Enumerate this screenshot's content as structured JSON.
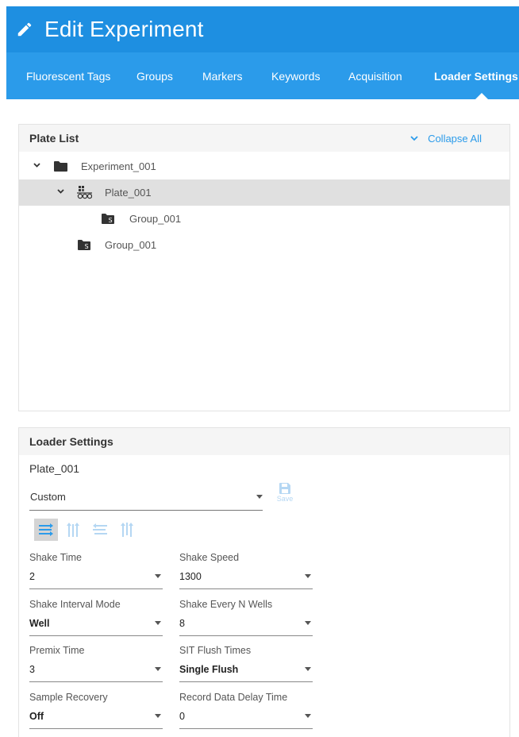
{
  "header": {
    "title": "Edit Experiment",
    "icon": "pencil-icon"
  },
  "tabs": [
    {
      "label": "Fluorescent Tags"
    },
    {
      "label": "Groups"
    },
    {
      "label": "Markers"
    },
    {
      "label": "Keywords"
    },
    {
      "label": "Acquisition"
    },
    {
      "label": "Loader Settings",
      "active": true
    }
  ],
  "plate_list": {
    "title": "Plate List",
    "collapse_label": "Collapse All",
    "tree": [
      {
        "label": "Experiment_001",
        "icon": "folder-icon",
        "expanded": true
      },
      {
        "label": "Plate_001",
        "icon": "plate-icon",
        "expanded": true,
        "selected": true
      },
      {
        "label": "Group_001",
        "icon": "group-folder-icon",
        "badge": "S"
      },
      {
        "label": "Group_001",
        "icon": "group-folder-icon",
        "badge": "S"
      }
    ]
  },
  "loader_settings": {
    "title": "Loader Settings",
    "plate_name": "Plate_001",
    "preset": "Custom",
    "save_label": "Save",
    "fields": [
      {
        "label": "Shake Time",
        "value": "2",
        "bold": false
      },
      {
        "label": "Shake Speed",
        "value": "1300",
        "bold": false
      },
      {
        "label": "Shake Interval Mode",
        "value": "Well",
        "bold": true
      },
      {
        "label": "Shake Every N Wells",
        "value": "8",
        "bold": false
      },
      {
        "label": "Premix Time",
        "value": "3",
        "bold": false
      },
      {
        "label": "SIT Flush Times",
        "value": "Single Flush",
        "bold": true
      },
      {
        "label": "Sample Recovery",
        "value": "Off",
        "bold": true
      },
      {
        "label": "Record Data Delay Time",
        "value": "0",
        "bold": false
      }
    ]
  },
  "colors": {
    "header": "#1e8fe1",
    "tabs": "#2b9bea",
    "accent": "#2b9bea",
    "selected_row": "#e0e0e0"
  }
}
